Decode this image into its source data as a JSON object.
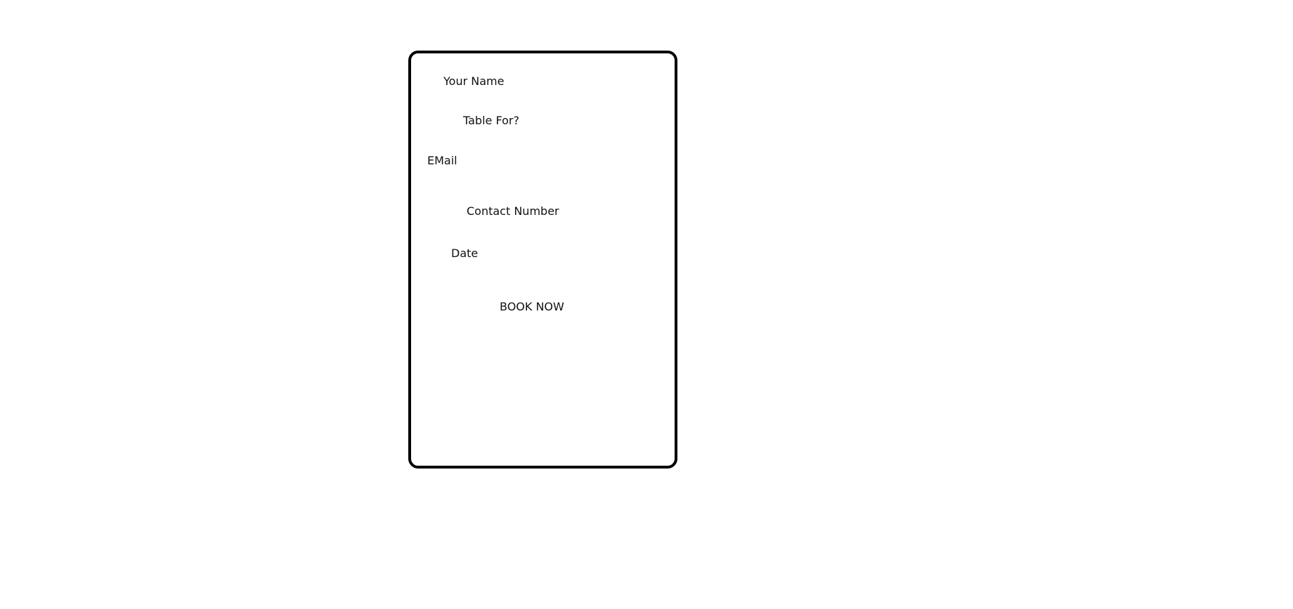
{
  "booking_form": {
    "fields": {
      "name_label": "Your Name",
      "table_for_label": "Table For?",
      "email_label": "EMail",
      "contact_number_label": "Contact Number",
      "date_label": "Date"
    },
    "submit_label": "BOOK NOW"
  }
}
